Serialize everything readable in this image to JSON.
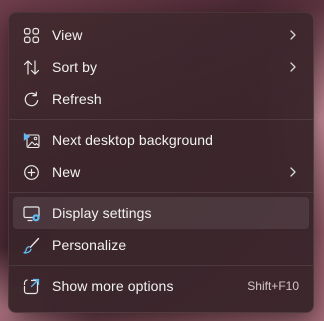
{
  "context_menu": {
    "items": [
      {
        "label": "View",
        "icon": "grid-view-icon",
        "has_submenu": true
      },
      {
        "label": "Sort by",
        "icon": "sort-arrows-icon",
        "has_submenu": true
      },
      {
        "label": "Refresh",
        "icon": "refresh-icon",
        "has_submenu": false
      },
      {
        "label": "Next desktop background",
        "icon": "next-background-icon",
        "has_submenu": false
      },
      {
        "label": "New",
        "icon": "plus-circle-icon",
        "has_submenu": true
      },
      {
        "label": "Display settings",
        "icon": "display-settings-icon",
        "has_submenu": false,
        "highlighted": true
      },
      {
        "label": "Personalize",
        "icon": "brush-icon",
        "has_submenu": false
      },
      {
        "label": "Show more options",
        "icon": "open-external-icon",
        "shortcut": "Shift+F10"
      }
    ]
  },
  "colors": {
    "menu_background": "#3d272d",
    "text": "#f2f2f2",
    "icon_accent": "#60b8f0",
    "hover_background": "#4a3539"
  }
}
